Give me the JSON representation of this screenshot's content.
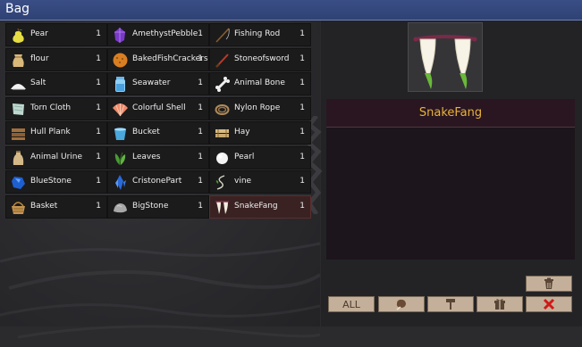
{
  "window": {
    "title": "Bag"
  },
  "inventory": {
    "columns": [
      [
        {
          "name": "Pear",
          "count": "1",
          "icon": "pear-icon"
        },
        {
          "name": "flour",
          "count": "1",
          "icon": "flour-sack-icon"
        },
        {
          "name": "Salt",
          "count": "1",
          "icon": "salt-pile-icon"
        },
        {
          "name": "Torn Cloth",
          "count": "1",
          "icon": "cloth-icon"
        },
        {
          "name": "Hull Plank",
          "count": "1",
          "icon": "plank-icon"
        },
        {
          "name": "Animal Urine",
          "count": "1",
          "icon": "urine-bag-icon"
        },
        {
          "name": "BlueStone",
          "count": "1",
          "icon": "blue-stone-icon"
        },
        {
          "name": "Basket",
          "count": "1",
          "icon": "basket-icon"
        }
      ],
      [
        {
          "name": "AmethystPebble",
          "count": "1",
          "icon": "amethyst-icon"
        },
        {
          "name": "BakedFishCrackers",
          "count": "1",
          "icon": "cracker-icon"
        },
        {
          "name": "Seawater",
          "count": "1",
          "icon": "water-jar-icon"
        },
        {
          "name": "Colorful Shell",
          "count": "1",
          "icon": "shell-icon"
        },
        {
          "name": "Bucket",
          "count": "1",
          "icon": "bucket-icon"
        },
        {
          "name": "Leaves",
          "count": "1",
          "icon": "leaves-icon"
        },
        {
          "name": "CristonePart",
          "count": "1",
          "icon": "crystal-icon"
        },
        {
          "name": "BigStone",
          "count": "1",
          "icon": "stone-icon"
        }
      ],
      [
        {
          "name": "Fishing Rod",
          "count": "1",
          "icon": "fishing-rod-icon"
        },
        {
          "name": "Stoneofsword",
          "count": "1",
          "icon": "stone-sword-icon"
        },
        {
          "name": "Animal Bone",
          "count": "1",
          "icon": "bone-icon"
        },
        {
          "name": "Nylon Rope",
          "count": "1",
          "icon": "rope-icon"
        },
        {
          "name": "Hay",
          "count": "1",
          "icon": "hay-icon"
        },
        {
          "name": "Pearl",
          "count": "1",
          "icon": "pearl-icon"
        },
        {
          "name": "vine",
          "count": "1",
          "icon": "vine-icon"
        },
        {
          "name": "SnakeFang",
          "count": "1",
          "icon": "snake-fang-icon",
          "selected": true
        }
      ]
    ]
  },
  "detail": {
    "item_name": "SnakeFang",
    "preview_icon": "snake-fang-icon",
    "description": ""
  },
  "actions": {
    "delete_icon": "trash-icon",
    "all_label": "ALL",
    "food_icon": "meat-icon",
    "tool_icon": "hammer-icon",
    "gift_icon": "gift-icon",
    "close_icon": "close-icon"
  },
  "colors": {
    "title_bar": "#34487e",
    "item_name": "#e8b23c",
    "slot_bg": "#1b1b1c",
    "selected_slot": "#3a2222",
    "button": "#c4b09a",
    "close_red": "#d01818"
  }
}
